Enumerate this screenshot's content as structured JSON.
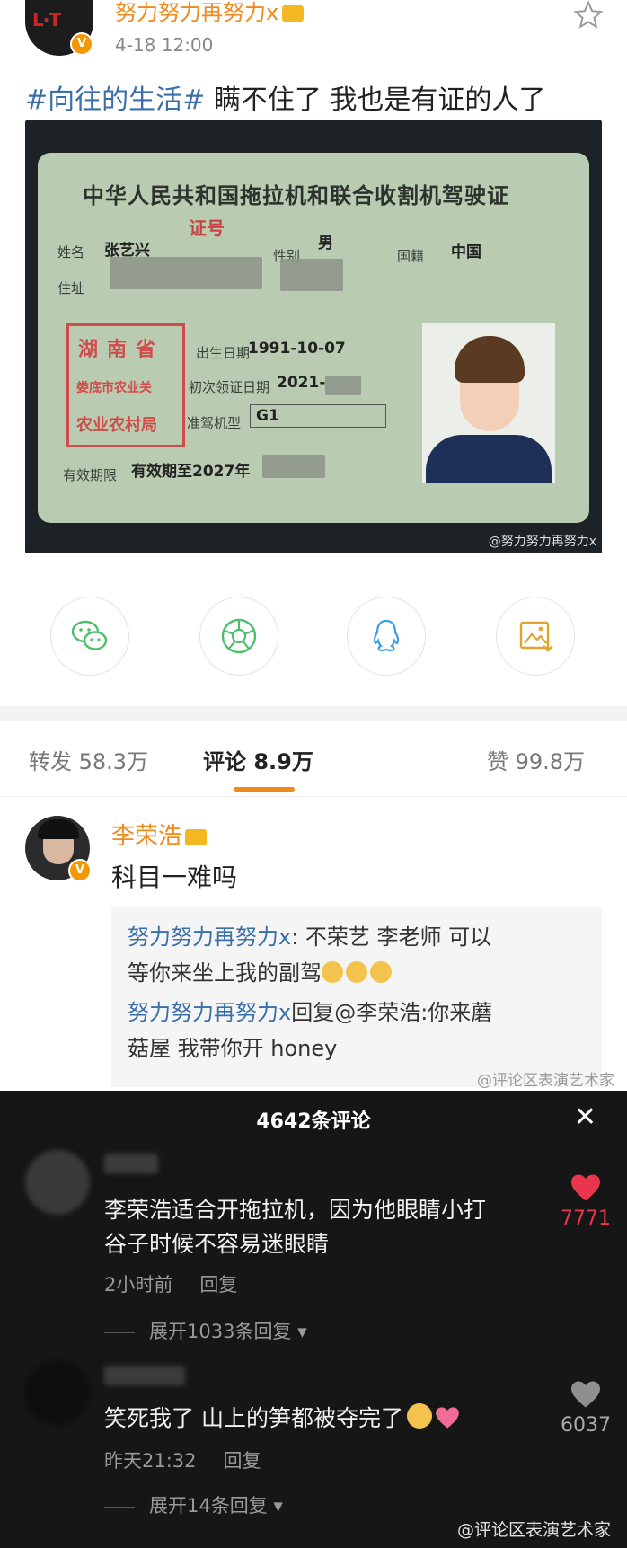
{
  "post": {
    "author": "努力努力再努力x",
    "date": "4-18 12:00",
    "hashtag": "#向往的生活#",
    "text": " 瞒不住了 我也是有证的人了",
    "verified_badge": "V"
  },
  "license": {
    "title": "中华人民共和国拖拉机和联合收割机驾驶证",
    "cert_no_label": "证号",
    "name_label": "姓名",
    "name_value": "张艺兴",
    "sex_label": "性别",
    "sex_value": "男",
    "nation_label": "国籍",
    "nation_value": "中国",
    "address_label": "住址",
    "birth_label": "出生日期",
    "birth_value": "1991-10-07",
    "first_issue_label": "初次领证日期",
    "first_issue_value": "2021-",
    "vehicle_label": "准驾机型",
    "vehicle_value": "G1",
    "validity_label": "有效期限",
    "validity_value": "有效期至2027年",
    "stamp_line1": "湖南省",
    "stamp_line2": "娄底市农业关",
    "stamp_line3": "农业农村局",
    "watermark": "@努力努力再努力x"
  },
  "share_icons": [
    "wechat-icon",
    "moments-icon",
    "qq-icon",
    "save-image-icon"
  ],
  "tabs": {
    "repost": "转发 58.3万",
    "comments": "评论 8.9万",
    "likes": "赞 99.8万"
  },
  "comment": {
    "author": "李荣浩",
    "text": "科目一难吗",
    "replies": [
      {
        "user": "努力努力再努力x",
        "text": ": 不荣艺  李老师 可以"
      },
      {
        "user": "",
        "text": "等你来坐上我的副驾"
      },
      {
        "user": "努力努力再努力x",
        "text": "回复@李荣浩:你来蘑"
      },
      {
        "user": "",
        "text": "菇屋 我带你开 honey"
      }
    ],
    "watermark": "@评论区表演艺术家"
  },
  "dark_panel": {
    "title": "4642条评论",
    "close": "✕",
    "comments": [
      {
        "line1": "李荣浩适合开拖拉机，因为他眼睛小打",
        "line2": "谷子时候不容易迷眼睛",
        "time": "2小时前",
        "reply": "回复",
        "expand": "展开1033条回复",
        "likes": "7771",
        "liked": true
      },
      {
        "line1": "笑死我了 山上的笋都被夺完了",
        "time": "昨天21:32",
        "reply": "回复",
        "expand": "展开14条回复",
        "likes": "6037",
        "liked": false
      }
    ],
    "watermark": "@评论区表演艺术家"
  },
  "colors": {
    "accent_orange": "#f08a1c",
    "link_blue": "#3b6fa9",
    "like_red": "#e8364d"
  }
}
